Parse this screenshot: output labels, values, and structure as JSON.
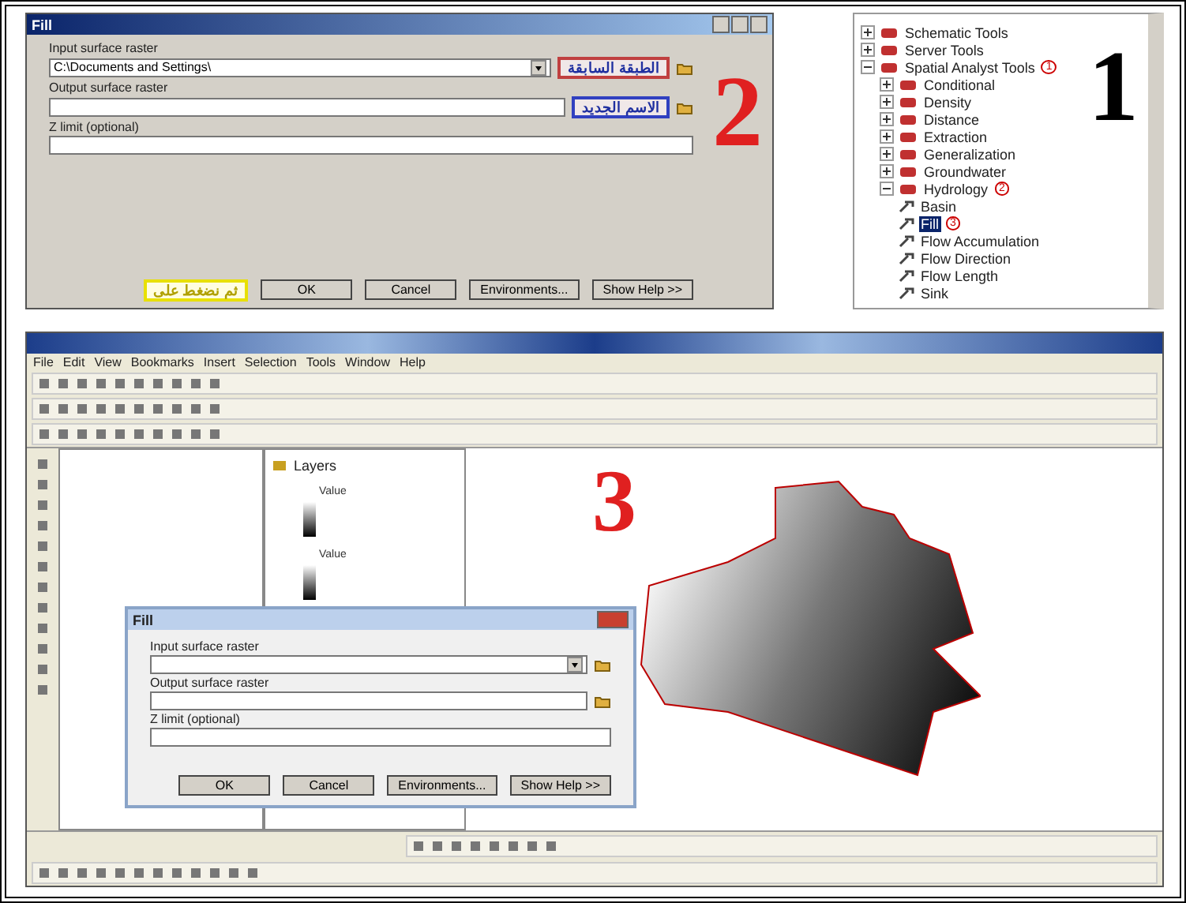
{
  "step_2_dialog": {
    "title": "Fill",
    "step_number": "2",
    "fields": [
      {
        "label": "Input surface raster",
        "value": "C:\\Documents and Settings\\",
        "kind": "dropdown",
        "annotation": "الطبقة السابقة"
      },
      {
        "label": "Output surface raster",
        "kind": "text",
        "annotation": "الاسم الجديد"
      },
      {
        "label": "Z limit (optional)",
        "kind": "text"
      }
    ],
    "buttons": [
      {
        "label": "OK",
        "annotation": "ثم نضغط على"
      },
      {
        "label": "Cancel"
      },
      {
        "label": "Environments..."
      },
      {
        "label": "Show Help >>"
      }
    ]
  },
  "step_1_toolbox": {
    "step_number": "1",
    "items": [
      {
        "label": "Schematic Tools",
        "expanded": false
      },
      {
        "label": "Server Tools",
        "expanded": false
      },
      {
        "label": "Spatial Analyst Tools",
        "expanded": true,
        "marker": "1",
        "children": [
          {
            "label": "Conditional",
            "expanded": false
          },
          {
            "label": "Density",
            "expanded": false
          },
          {
            "label": "Distance",
            "expanded": false
          },
          {
            "label": "Extraction",
            "expanded": false
          },
          {
            "label": "Generalization",
            "expanded": false
          },
          {
            "label": "Groundwater",
            "expanded": false
          },
          {
            "label": "Hydrology",
            "expanded": true,
            "marker": "2",
            "children": [
              {
                "label": "Basin",
                "kind": "tool",
                "selected": false
              },
              {
                "label": "Fill",
                "kind": "tool",
                "selected": true,
                "marker": "3"
              },
              {
                "label": "Flow Accumulation",
                "kind": "tool",
                "selected": false
              },
              {
                "label": "Flow Direction",
                "kind": "tool",
                "selected": false
              },
              {
                "label": "Flow Length",
                "kind": "tool",
                "selected": false
              },
              {
                "label": "Sink",
                "kind": "tool",
                "selected": false
              }
            ]
          }
        ]
      }
    ]
  },
  "arcmap": {
    "step_number": "3",
    "menu": [
      "File",
      "Edit",
      "View",
      "Bookmarks",
      "Insert",
      "Selection",
      "Tools",
      "Window",
      "Help"
    ],
    "toc": [
      {
        "label": "Layers",
        "legend": [
          "Value",
          "Value"
        ]
      }
    ],
    "dialog": {
      "title": "Fill",
      "fields": [
        {
          "label": "Input surface raster",
          "kind": "dropdown"
        },
        {
          "label": "Output surface raster",
          "kind": "text"
        },
        {
          "label": "Z limit (optional)",
          "kind": "text"
        }
      ],
      "buttons": [
        "OK",
        "Cancel",
        "Environments...",
        "Show Help >>"
      ]
    }
  }
}
